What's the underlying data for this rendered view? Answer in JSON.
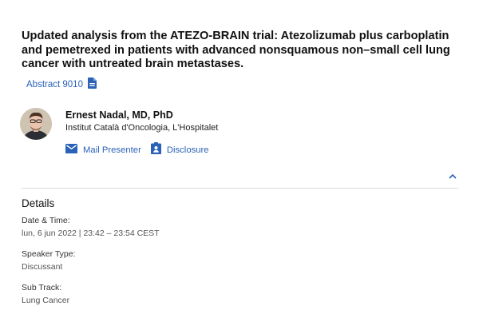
{
  "session": {
    "title": "Updated analysis from the ATEZO-BRAIN trial: Atezolizumab plus carboplatin and pemetrexed in patients with advanced nonsquamous non–small cell lung cancer with untreated brain metastases.",
    "abstract_label": "Abstract 9010"
  },
  "presenter": {
    "name": "Ernest Nadal, MD, PhD",
    "affiliation": "Institut Català d'Oncologia, L'Hospitalet",
    "mail_label": "Mail Presenter",
    "disclosure_label": "Disclosure"
  },
  "details": {
    "heading": "Details",
    "date_label": "Date & Time:",
    "date_value": "lun, 6 jun 2022 | 23:42 – 23:54 CEST",
    "speaker_type_label": "Speaker Type:",
    "speaker_type_value": "Discussant",
    "sub_track_label": "Sub Track:",
    "sub_track_value": "Lung Cancer"
  },
  "colors": {
    "link": "#2a62b8",
    "divider": "#dcdcdc"
  },
  "icons": {
    "abstract": "document-icon",
    "mail": "mail-icon",
    "disclosure": "badge-icon",
    "collapse": "chevron-up-icon"
  }
}
